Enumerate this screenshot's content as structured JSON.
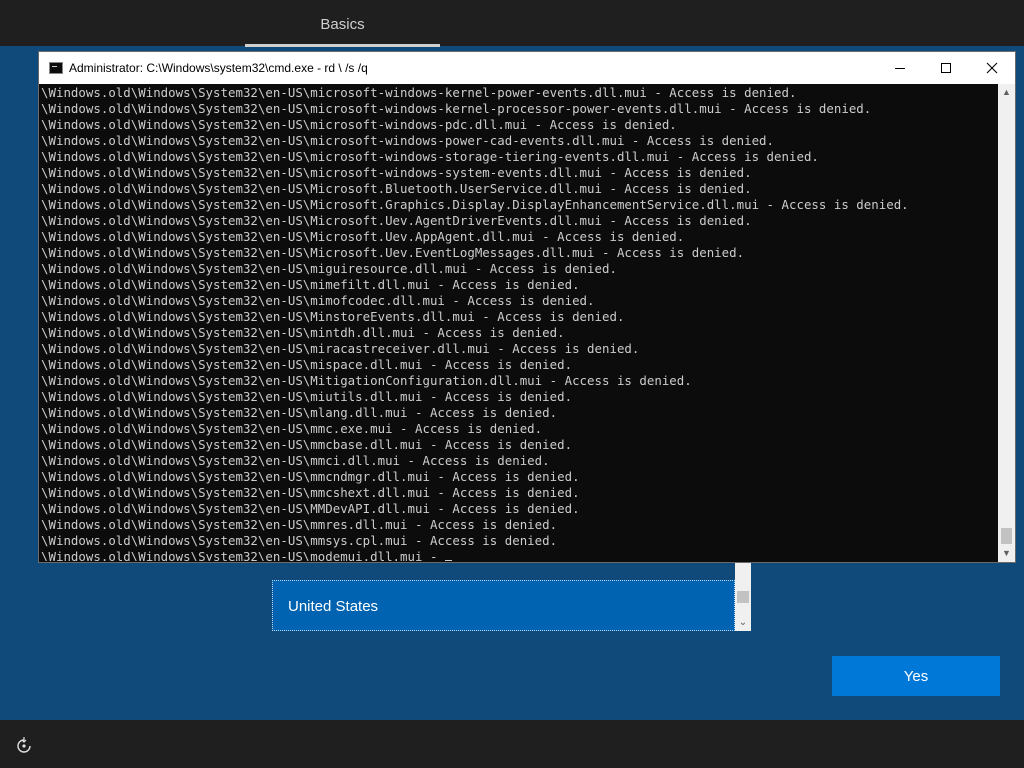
{
  "oobe": {
    "tab_label": "Basics",
    "region_selected": "United States",
    "yes_label": "Yes"
  },
  "cmd": {
    "title": "Administrator: C:\\Windows\\system32\\cmd.exe - rd \\ /s /q",
    "lines": [
      "\\Windows.old\\Windows\\System32\\en-US\\microsoft-windows-kernel-power-events.dll.mui - Access is denied.",
      "\\Windows.old\\Windows\\System32\\en-US\\microsoft-windows-kernel-processor-power-events.dll.mui - Access is denied.",
      "\\Windows.old\\Windows\\System32\\en-US\\microsoft-windows-pdc.dll.mui - Access is denied.",
      "\\Windows.old\\Windows\\System32\\en-US\\microsoft-windows-power-cad-events.dll.mui - Access is denied.",
      "\\Windows.old\\Windows\\System32\\en-US\\microsoft-windows-storage-tiering-events.dll.mui - Access is denied.",
      "\\Windows.old\\Windows\\System32\\en-US\\microsoft-windows-system-events.dll.mui - Access is denied.",
      "\\Windows.old\\Windows\\System32\\en-US\\Microsoft.Bluetooth.UserService.dll.mui - Access is denied.",
      "\\Windows.old\\Windows\\System32\\en-US\\Microsoft.Graphics.Display.DisplayEnhancementService.dll.mui - Access is denied.",
      "\\Windows.old\\Windows\\System32\\en-US\\Microsoft.Uev.AgentDriverEvents.dll.mui - Access is denied.",
      "\\Windows.old\\Windows\\System32\\en-US\\Microsoft.Uev.AppAgent.dll.mui - Access is denied.",
      "\\Windows.old\\Windows\\System32\\en-US\\Microsoft.Uev.EventLogMessages.dll.mui - Access is denied.",
      "\\Windows.old\\Windows\\System32\\en-US\\miguiresource.dll.mui - Access is denied.",
      "\\Windows.old\\Windows\\System32\\en-US\\mimefilt.dll.mui - Access is denied.",
      "\\Windows.old\\Windows\\System32\\en-US\\mimofcodec.dll.mui - Access is denied.",
      "\\Windows.old\\Windows\\System32\\en-US\\MinstoreEvents.dll.mui - Access is denied.",
      "\\Windows.old\\Windows\\System32\\en-US\\mintdh.dll.mui - Access is denied.",
      "\\Windows.old\\Windows\\System32\\en-US\\miracastreceiver.dll.mui - Access is denied.",
      "\\Windows.old\\Windows\\System32\\en-US\\mispace.dll.mui - Access is denied.",
      "\\Windows.old\\Windows\\System32\\en-US\\MitigationConfiguration.dll.mui - Access is denied.",
      "\\Windows.old\\Windows\\System32\\en-US\\miutils.dll.mui - Access is denied.",
      "\\Windows.old\\Windows\\System32\\en-US\\mlang.dll.mui - Access is denied.",
      "\\Windows.old\\Windows\\System32\\en-US\\mmc.exe.mui - Access is denied.",
      "\\Windows.old\\Windows\\System32\\en-US\\mmcbase.dll.mui - Access is denied.",
      "\\Windows.old\\Windows\\System32\\en-US\\mmci.dll.mui - Access is denied.",
      "\\Windows.old\\Windows\\System32\\en-US\\mmcndmgr.dll.mui - Access is denied.",
      "\\Windows.old\\Windows\\System32\\en-US\\mmcshext.dll.mui - Access is denied.",
      "\\Windows.old\\Windows\\System32\\en-US\\MMDevAPI.dll.mui - Access is denied.",
      "\\Windows.old\\Windows\\System32\\en-US\\mmres.dll.mui - Access is denied.",
      "\\Windows.old\\Windows\\System32\\en-US\\mmsys.cpl.mui - Access is denied.",
      "\\Windows.old\\Windows\\System32\\en-US\\modemui.dll.mui -"
    ]
  },
  "icons": {
    "accessibility": "ease-of-access-icon",
    "cmd_app": "cmd-app-icon",
    "minimize": "minimize-icon",
    "maximize": "maximize-icon",
    "close": "close-icon"
  },
  "colors": {
    "oobe_background": "#0f4a7b",
    "bars": "#1f1f1f",
    "selected_item": "#0063b1",
    "yes_button": "#0078d7",
    "console_background": "#0c0c0c",
    "console_text": "#cccccc"
  }
}
